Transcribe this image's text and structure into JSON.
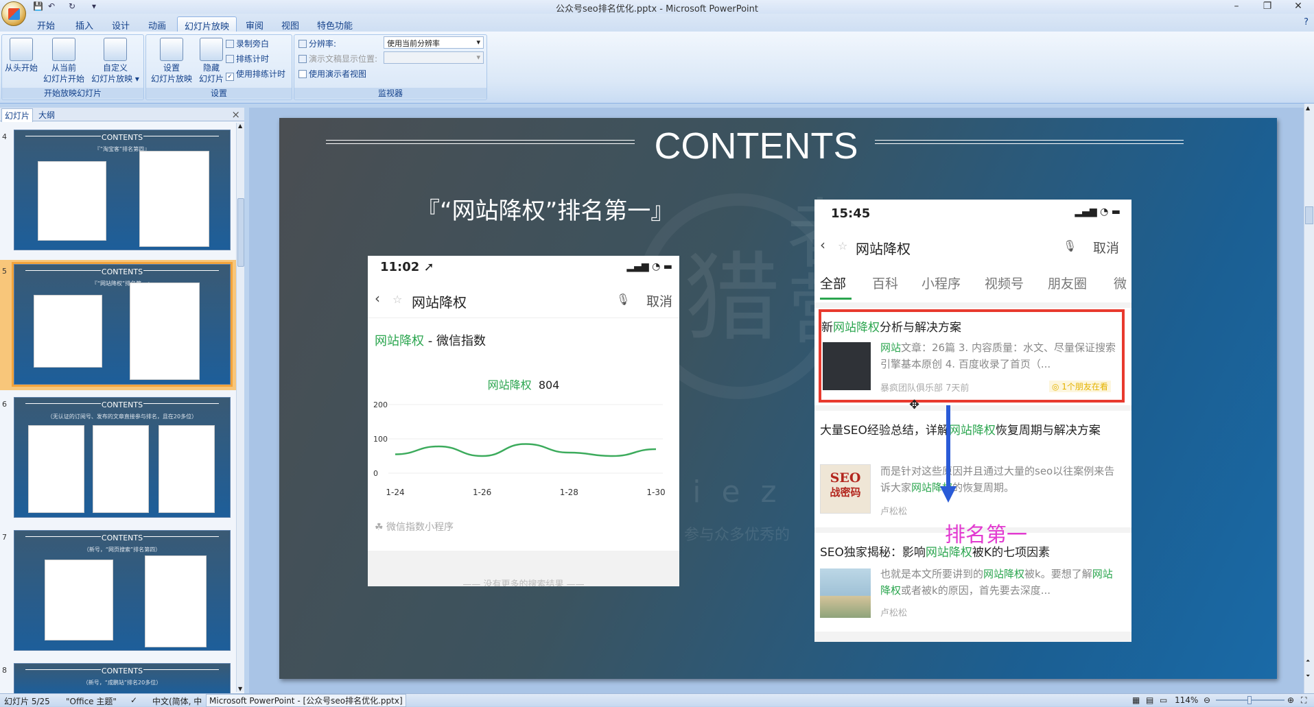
{
  "window": {
    "title": "公众号seo排名优化.pptx - Microsoft PowerPoint",
    "min": "–",
    "max": "❐",
    "close": "✕"
  },
  "ribbon": {
    "tabs": [
      "开始",
      "插入",
      "设计",
      "动画",
      "幻灯片放映",
      "审阅",
      "视图",
      "特色功能"
    ],
    "active_tab": "幻灯片放映",
    "groups": {
      "start": {
        "title": "开始放映幻灯片",
        "from_start_1": "从头开始",
        "from_current_1": "从当前",
        "from_current_2": "幻灯片开始",
        "custom_1": "自定义",
        "custom_2": "幻灯片放映 ▾"
      },
      "setup": {
        "title": "设置",
        "setup_1": "设置",
        "setup_2": "幻灯片放映",
        "hide_1": "隐藏",
        "hide_2": "幻灯片",
        "record": "录制旁白",
        "rehearse": "排练计时",
        "use_timings": "使用排练计时"
      },
      "monitor": {
        "title": "监视器",
        "resolution_label": "分辨率:",
        "resolution_value": "使用当前分辨率",
        "show_on_label": "演示文稿显示位置:",
        "presenter_view": "使用演示者视图"
      }
    }
  },
  "left_pane": {
    "tab_slides": "幻灯片",
    "tab_outline": "大纲",
    "close": "×"
  },
  "thumbs": [
    {
      "num": "4",
      "title": "CONTENTS",
      "subtitle": "『“淘宝客”排名第四』"
    },
    {
      "num": "5",
      "title": "CONTENTS",
      "subtitle": "『“网站降权”排名第一』"
    },
    {
      "num": "6",
      "title": "CONTENTS",
      "subtitle": "（无认证的订阅号、发布的文章直接参与排名，且在20多位）"
    },
    {
      "num": "7",
      "title": "CONTENTS",
      "subtitle": "（新号，“网页搜索”排名第四）"
    },
    {
      "num": "8",
      "title": "CONTENTS",
      "subtitle": "（新号，“成鹏站”排名20多位）"
    }
  ],
  "slide": {
    "title": "CONTENTS",
    "subtitle": "『“网站降权”排名第一』",
    "watermark_cn": "猎",
    "watermark_cn2": "者",
    "watermark_cn3": "营",
    "watermark_en": "liez",
    "watermark_tag": "参与众多优秀的",
    "phone1": {
      "time": "11:02",
      "search_term": "网站降权",
      "cancel": "取消",
      "index_title_green": "网站降权",
      "index_title_rest": " - 微信指数",
      "chart_label_green": "网站降权",
      "chart_value": "804",
      "footer_link": "微信指数小程序",
      "no_more": "—— 没有更多的搜索结果 ——"
    },
    "phone2": {
      "time": "15:45",
      "search_term": "网站降权",
      "cancel": "取消",
      "tabs": [
        "全部",
        "百科",
        "小程序",
        "视频号",
        "朋友圈",
        "微"
      ],
      "results": [
        {
          "title_pre": "新",
          "title_green": "网站降权",
          "title_post": "分析与解决方案",
          "snippet_green": "网站",
          "snippet": "文章：26篇 3. 内容质量：水文、尽量保证搜索引擎基本原创 4. 百度收录了首页（...",
          "source": "暴疯团队俱乐部  7天前",
          "badge": "◎ 1个朋友在看"
        },
        {
          "title_pre": "大量SEO经验总结，详解",
          "title_green": "网站降权",
          "title_post": "恢复周期与解决方案",
          "snippet_pre": "而是针对这些原因并且通过大量的seo以往案例来告诉大家",
          "snippet_green": "网站降权",
          "snippet_post": "的恢复周期。",
          "source": "卢松松",
          "thumb_text1": "SEO",
          "thumb_text2": "战密码"
        },
        {
          "title_pre": "SEO独家揭秘：影响",
          "title_green": "网站降权",
          "title_post": "被K的七项因素",
          "snippet_pre": "也就是本文所要讲到的",
          "snippet_green": "网站降权",
          "snippet_mid": "被k。要想了解",
          "snippet_green2": "网站降权",
          "snippet_post": "或者被k的原因，首先要去深度...",
          "source": "卢松松"
        }
      ],
      "annotation": "排名第一"
    }
  },
  "chart_data": {
    "type": "line",
    "title": "网站降权 804",
    "x": [
      "1-24",
      "1-25",
      "1-26",
      "1-27",
      "1-28",
      "1-29",
      "1-30"
    ],
    "series": [
      {
        "name": "网站降权",
        "values": [
          55,
          78,
          50,
          85,
          60,
          50,
          70
        ]
      }
    ],
    "yticks": [
      "200",
      "100",
      "0"
    ],
    "xticks": [
      "1-24",
      "1-26",
      "1-28",
      "1-30"
    ],
    "ylim": [
      0,
      200
    ],
    "color": "#3cab5c"
  },
  "status": {
    "slide": "幻灯片 5/25",
    "theme": "\"Office 主题\"",
    "lang": "中文(简体, 中",
    "task": "Microsoft PowerPoint - [公众号seo排名优化.pptx]",
    "zoom": "114%"
  }
}
